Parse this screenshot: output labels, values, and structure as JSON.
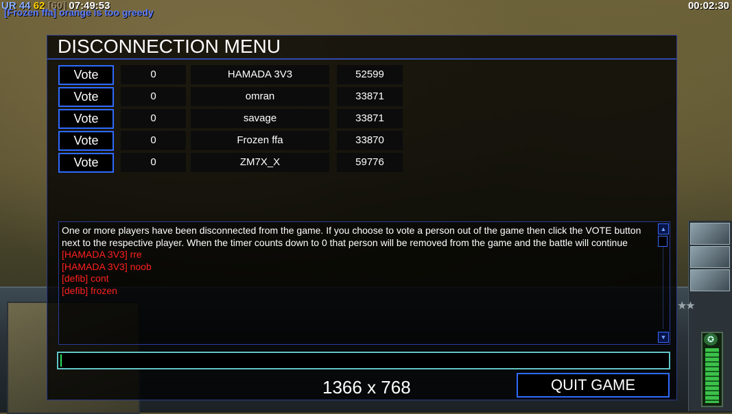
{
  "hud": {
    "stat_a": "UR 44",
    "stat_b": "62",
    "stat_c": "[60]",
    "clock": "07:49:53",
    "chat_overlay": "[Frozen ffa] orange is too greedy",
    "game_timer": "00:02:30"
  },
  "dialog": {
    "title": "DISCONNECTION MENU",
    "vote_label": "Vote",
    "players": [
      {
        "votes": "0",
        "name": "HAMADA 3V3",
        "timer": "52599"
      },
      {
        "votes": "0",
        "name": "omran",
        "timer": "33871"
      },
      {
        "votes": "0",
        "name": "savage",
        "timer": "33871"
      },
      {
        "votes": "0",
        "name": "Frozen ffa",
        "timer": "33870"
      },
      {
        "votes": "0",
        "name": "ZM7X_X",
        "timer": "59776"
      }
    ],
    "system_message": "One or more players have been disconnected from the game. If you choose to vote a person out of the game then click the VOTE button next to the respective player. When the timer counts down to 0 that person will be removed from the game and the battle will continue",
    "messages": [
      "[HAMADA 3V3] rre",
      "[HAMADA 3V3] noob",
      "[defib] cont",
      "[defib] frozen"
    ],
    "chat_input_value": "",
    "resolution": "1366 x 768",
    "quit_label": "QUIT GAME"
  },
  "icons": {
    "scroll_up": "scroll-up-arrow-icon",
    "scroll_down": "scroll-down-arrow-icon",
    "power": "power-star-icon"
  },
  "colors": {
    "accent_border": "#2f6bff",
    "chat_red": "#ff2020",
    "input_border": "#62c6c6"
  }
}
